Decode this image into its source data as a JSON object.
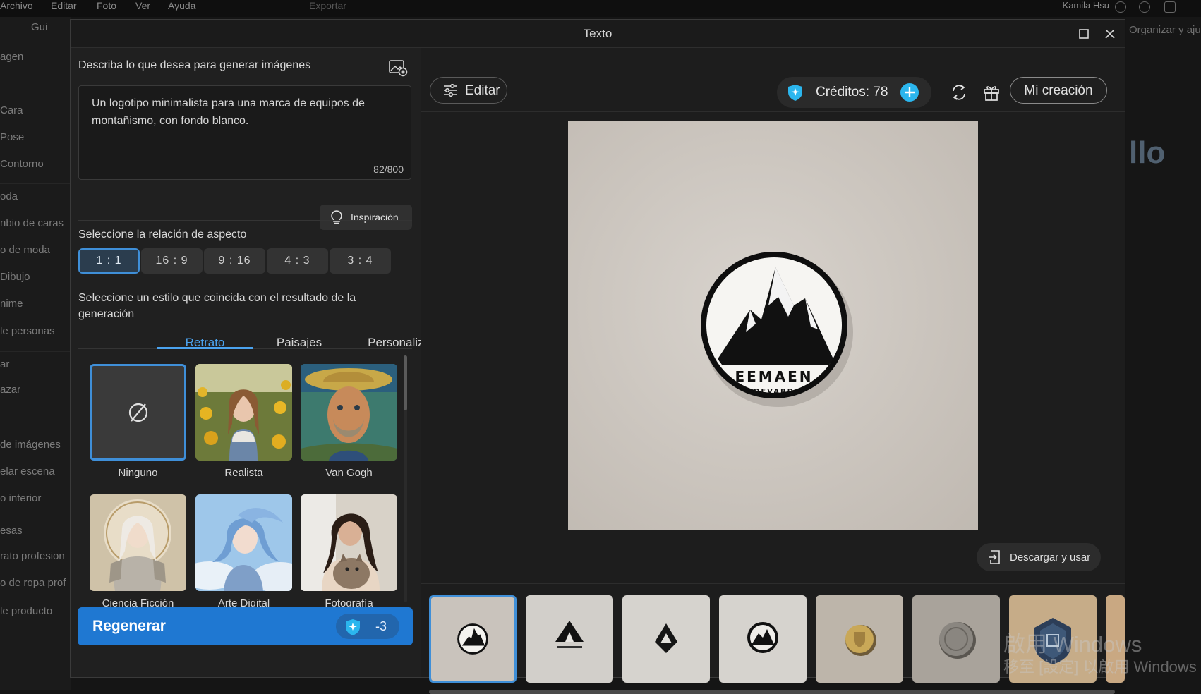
{
  "menu": {
    "items": [
      "Archivo",
      "Editar",
      "Foto",
      "Ver",
      "Ayuda"
    ],
    "export_label": "Exportar",
    "guide_label": "Gui",
    "user_name": "Kamila Hsu"
  },
  "background_sidebar": {
    "items": [
      "agen",
      "Cara",
      "Pose",
      "Contorno",
      "oda",
      "nbio de caras",
      "o de moda",
      "Dibujo",
      "nime",
      "le personas",
      "ar",
      "azar",
      "de imágenes",
      "elar escena",
      "o interior",
      "esas",
      "rato profesion",
      "o de ropa prof",
      "le producto"
    ]
  },
  "background_right": {
    "organize_label": "Organizar y aju",
    "big_text": "llo"
  },
  "dialog": {
    "title": "Texto"
  },
  "prompt": {
    "label": "Describa lo que desea para generar imágenes",
    "text": "Un logotipo minimalista para una marca de equipos de montañismo, con fondo blanco.",
    "counter": "82/800",
    "inspiration_label": "Inspiración"
  },
  "aspect": {
    "label": "Seleccione la relación de aspecto",
    "options": [
      "1 : 1",
      "16 : 9",
      "9 : 16",
      "4 : 3",
      "3 : 4"
    ],
    "selected": "1 : 1"
  },
  "style": {
    "label": "Seleccione un estilo que coincida con el resultado de la generación",
    "tabs": [
      "Retrato",
      "Paisajes",
      "Personalizado"
    ],
    "active_tab": "Retrato",
    "cards": [
      {
        "label": "Ninguno"
      },
      {
        "label": "Realista"
      },
      {
        "label": "Van Gogh"
      },
      {
        "label": "Ciencia Ficción"
      },
      {
        "label": "Arte Digital"
      },
      {
        "label": "Fotografía"
      }
    ]
  },
  "regenerate": {
    "label": "Regenerar",
    "cost": "-3"
  },
  "toolbar": {
    "edit_label": "Editar",
    "credits_label": "Créditos: 78",
    "my_creation_label": "Mi creación"
  },
  "preview": {
    "logo_text": "EEMAEN",
    "logo_subtext": "DEVARD"
  },
  "download_label": "Descargar y usar",
  "watermark": {
    "line1": "啟用 Windows",
    "line2": "移至 [設定] 以啟用 Windows"
  },
  "colors": {
    "accent": "#3f8fd8",
    "regen_bg": "#1f78d2",
    "credit_plus": "#2bb6ee"
  }
}
